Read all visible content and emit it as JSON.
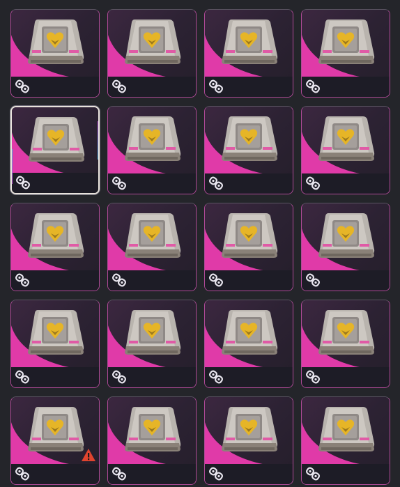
{
  "inventory": {
    "item_name_icon": "loot-box-heart-icon",
    "link_icon": "chain-link-icon",
    "accent_color": "#e03aa8",
    "border_color": "#b04a98",
    "rows": 5,
    "columns": 4,
    "selected_index": 4,
    "warning_index": 16,
    "warning_icon": "warning-triangle-icon",
    "warning_color": "#e0442e"
  }
}
